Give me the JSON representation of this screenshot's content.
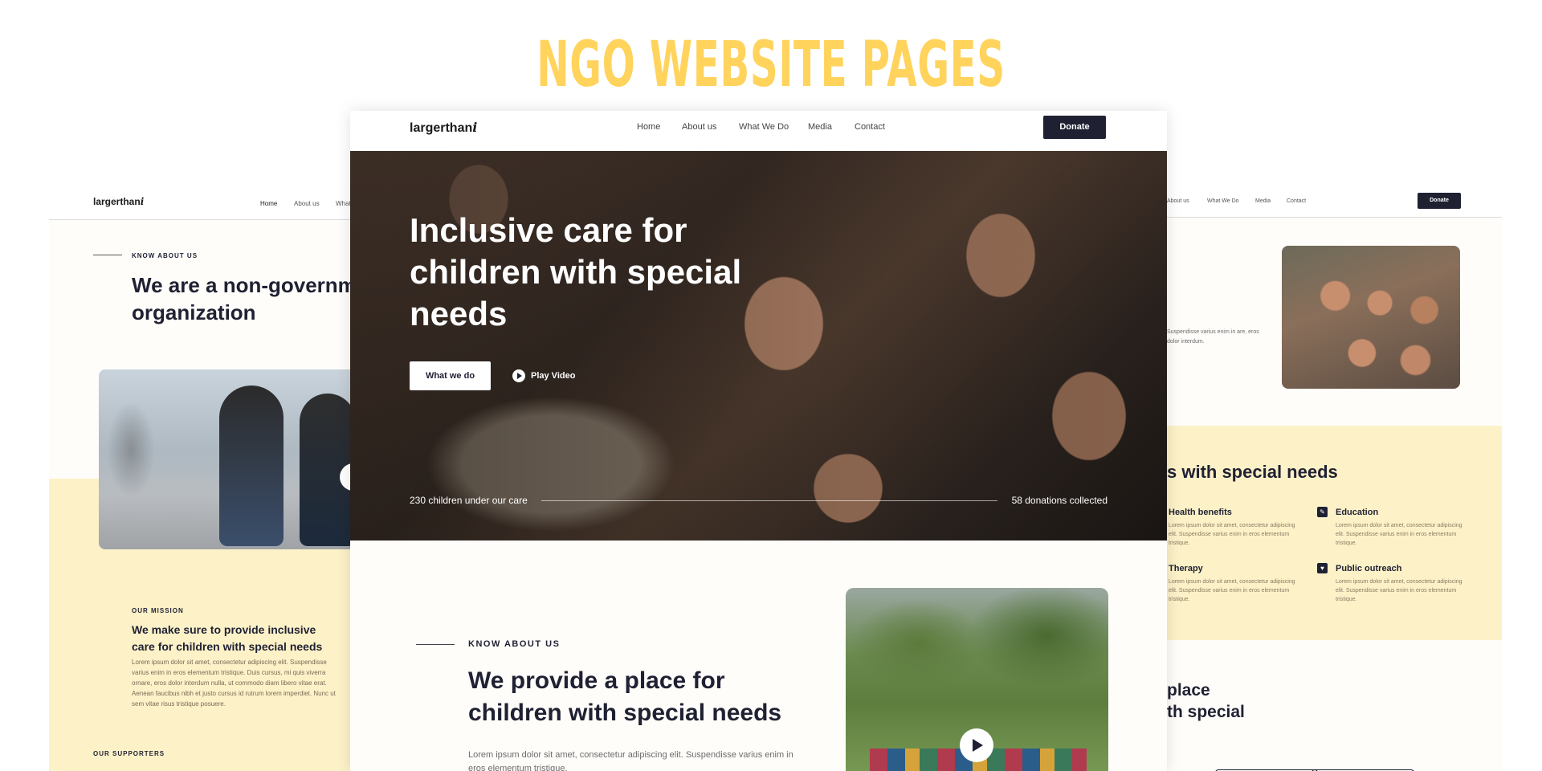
{
  "title": "NGO WEBSITE PAGES",
  "brand": {
    "name": "largerthan",
    "mark": "i"
  },
  "nav": [
    "Home",
    "About us",
    "What We Do",
    "Media",
    "Contact"
  ],
  "donate_label": "Donate",
  "left_page": {
    "nav": [
      "Home",
      "About us",
      "What"
    ],
    "kicker": "KNOW ABOUT US",
    "heading_line1": "We are a non-governm",
    "heading_line2": "organization",
    "mission_kicker": "OUR MISSION",
    "mission_heading": "We make sure to provide inclusive care for children with special needs",
    "mission_text": "Lorem ipsum dolor sit amet, consectetur adipiscing elit. Suspendisse varius enim in eros elementum tristique. Duis cursus, mi quis viverra ornare, eros dolor interdum nulla, ut commodo diam libero vitae erat. Aenean faucibus nibh et justo cursus id rutrum lorem imperdiet. Nunc ut sem vitae risus tristique posuere.",
    "supporters": "OUR SUPPORTERS"
  },
  "hero": {
    "heading": "Inclusive care for children with special needs",
    "cta": "What we do",
    "play": "Play Video",
    "stat_left": "230 children under our care",
    "stat_right": "58 donations collected",
    "progress": 1.0
  },
  "about": {
    "kicker": "KNOW ABOUT US",
    "heading": "We provide a place for children with special needs",
    "text": "Lorem ipsum dolor sit amet, consectetur adipiscing elit. Suspendisse varius enim in eros elementum tristique."
  },
  "right_page": {
    "nav": [
      "About us",
      "What We Do",
      "Media",
      "Contact"
    ],
    "snippet": "Suspendisse varius enim in are, eros dolor interdum.",
    "section_heading": "s with special needs",
    "features": [
      {
        "icon": "heart-icon",
        "title": "Health benefits",
        "text": "Lorem ipsum dolor sit amet, consectetur adipiscing elit. Suspendisse varius enim in eros elementum tristique."
      },
      {
        "icon": "book-icon",
        "title": "Education",
        "text": "Lorem ipsum dolor sit amet, consectetur adipiscing elit. Suspendisse varius enim in eros elementum tristique."
      },
      {
        "icon": "therapy-icon",
        "title": "Therapy",
        "text": "Lorem ipsum dolor sit amet, consectetur adipiscing elit. Suspendisse varius enim in eros elementum tristique."
      },
      {
        "icon": "outreach-icon",
        "title": "Public outreach",
        "text": "Lorem ipsum dolor sit amet, consectetur adipiscing elit. Suspendisse varius enim in eros elementum tristique."
      }
    ],
    "place_line1": "place",
    "place_line2": "th special"
  },
  "colors": {
    "accent": "#ffd35c",
    "dark": "#1f2133",
    "cream": "#fdf1c8"
  }
}
